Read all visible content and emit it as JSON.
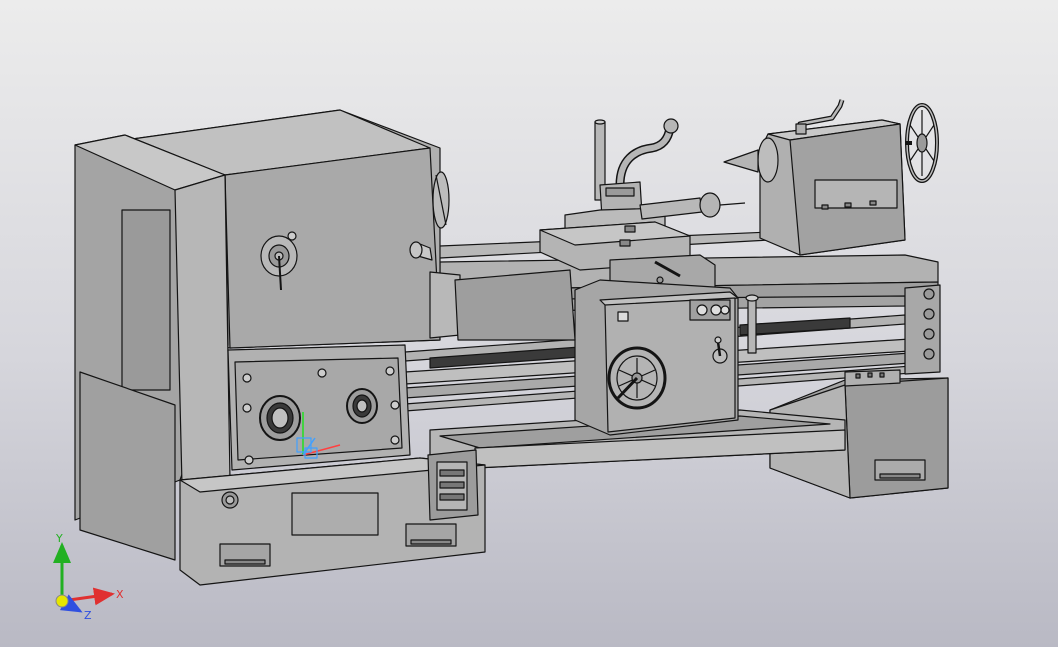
{
  "viewport": {
    "background_top": "#ececec",
    "background_bottom": "#b9b9c4",
    "model_fill": "#a9a9a9",
    "model_edge": "#141414"
  },
  "triad": {
    "x_label": "X",
    "y_label": "Y",
    "z_label": "Z",
    "x_color": "#e03030",
    "y_color": "#22b022",
    "z_color": "#3050e0",
    "origin_color": "#e6e600"
  },
  "local_triad": {
    "x_color": "#ff4040",
    "y_color": "#20e020",
    "z_color": "#40a0ff"
  }
}
